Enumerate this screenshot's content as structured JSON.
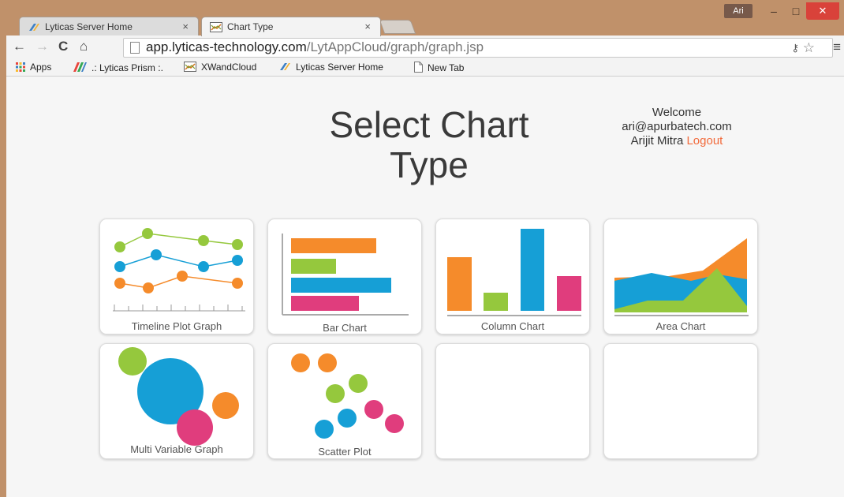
{
  "window": {
    "user_chip": "Ari",
    "min_glyph": "–",
    "max_glyph": "□",
    "close_glyph": "✕"
  },
  "tabs": [
    {
      "label": "Lyticas Server Home",
      "close": "×"
    },
    {
      "label": "Chart Type",
      "close": "×"
    }
  ],
  "toolbar": {
    "back": "←",
    "forward": "→",
    "reload": "C",
    "home": "⌂",
    "url_host": "app.lyticas-technology.com",
    "url_path": "/LytAppCloud/graph/graph.jsp",
    "key_glyph": "⚷",
    "star_glyph": "☆",
    "menu_glyph": "≡"
  },
  "bookmarks": [
    {
      "label": "Apps"
    },
    {
      "label": ".: Lyticas Prism :."
    },
    {
      "label": "XWandCloud"
    },
    {
      "label": "Lyticas Server Home"
    },
    {
      "label": "New Tab"
    }
  ],
  "page": {
    "title": "Select Chart Type",
    "welcome": "Welcome",
    "email": "ari@apurbatech.com",
    "user_name": "Arijit Mitra",
    "logout": "Logout"
  },
  "cards": [
    {
      "label": "Timeline Plot Graph"
    },
    {
      "label": "Bar Chart"
    },
    {
      "label": "Column Chart"
    },
    {
      "label": "Area Chart"
    },
    {
      "label": "Multi Variable Graph"
    },
    {
      "label": "Scatter Plot"
    }
  ],
  "colors": {
    "orange": "#f58b2b",
    "green": "#95c83d",
    "blue": "#169fd6",
    "pink": "#e03d7d",
    "logout": "#f26a3b",
    "titlebar": "#c0916a"
  }
}
